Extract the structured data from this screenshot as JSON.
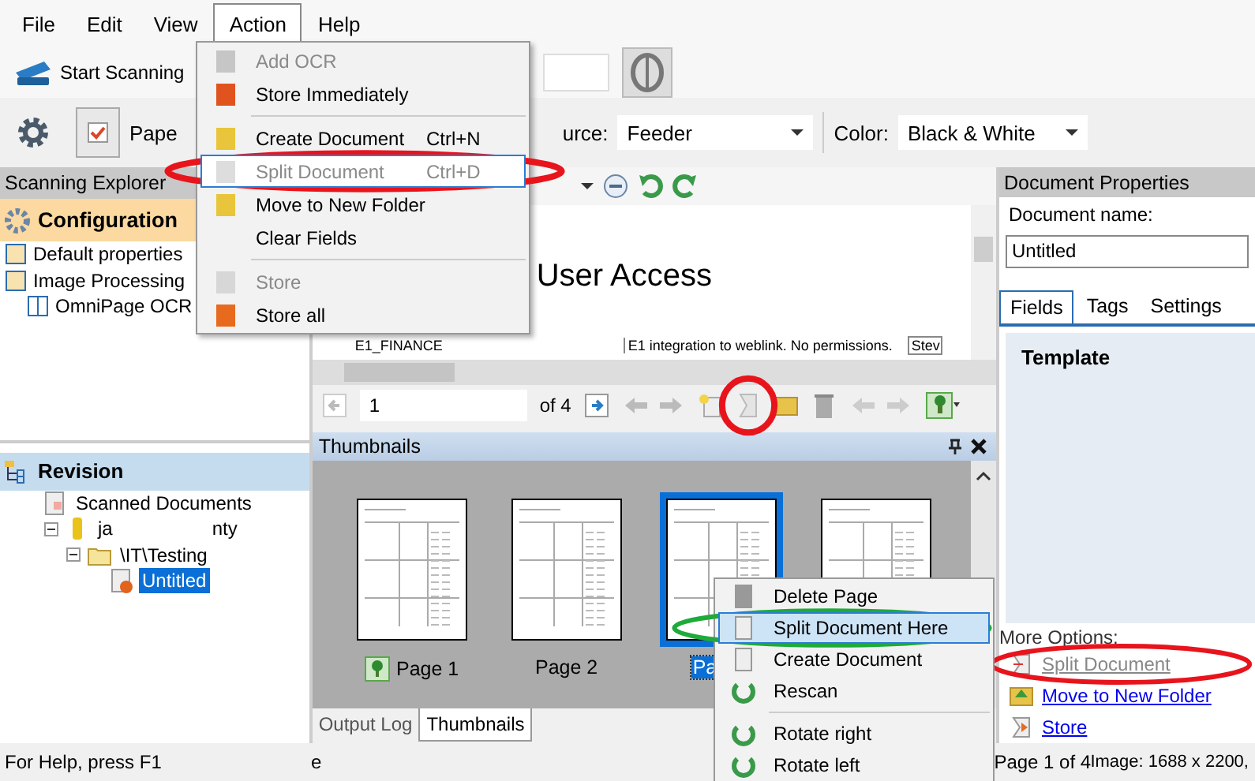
{
  "menubar": [
    {
      "label": "File",
      "selected": false
    },
    {
      "label": "Edit",
      "selected": false
    },
    {
      "label": "View",
      "selected": false
    },
    {
      "label": "Action",
      "selected": true
    },
    {
      "label": "Help",
      "selected": false
    }
  ],
  "action_menu": [
    {
      "kind": "item",
      "label": "Add OCR",
      "disabled": true,
      "highlighted": false
    },
    {
      "kind": "item",
      "label": "Store Immediately",
      "disabled": false,
      "highlighted": false
    },
    {
      "kind": "separator"
    },
    {
      "kind": "item",
      "label": "Create Document",
      "shortcut": "Ctrl+N",
      "disabled": false,
      "highlighted": false
    },
    {
      "kind": "item",
      "label": "Split Document",
      "shortcut": "Ctrl+D",
      "disabled": true,
      "highlighted": true
    },
    {
      "kind": "item",
      "label": "Move to New Folder",
      "disabled": false,
      "highlighted": false
    },
    {
      "kind": "item",
      "label": "Clear Fields",
      "disabled": false,
      "highlighted": false
    },
    {
      "kind": "separator"
    },
    {
      "kind": "item",
      "label": "Store",
      "disabled": true,
      "highlighted": false
    },
    {
      "kind": "item",
      "label": "Store all",
      "disabled": false,
      "highlighted": false
    }
  ],
  "toolbar": {
    "scan_button": "Start Scanning",
    "paper_label": "Pape",
    "source_label": "urce:",
    "source_value": "Feeder",
    "color_label": "Color:",
    "color_value": "Black & White"
  },
  "explorer": {
    "title": "Scanning Explorer",
    "configuration": "Configuration",
    "tree": [
      {
        "label": "Default properties"
      },
      {
        "label": "Image Processing",
        "children": [
          {
            "label": "OmniPage OCR"
          }
        ]
      }
    ]
  },
  "revision": {
    "title": "Revision",
    "tree": [
      {
        "label": "Scanned Documents",
        "selected": false,
        "children": [
          {
            "label": "ja",
            "label_end": "nty",
            "selected": false,
            "expanded": true,
            "children": [
              {
                "label": "\\IT\\Testing",
                "selected": false,
                "expanded": true,
                "children": [
                  {
                    "label": "Untitled",
                    "selected": true
                  }
                ]
              }
            ]
          }
        ]
      }
    ]
  },
  "viewer": {
    "heading": "User Access",
    "cell_left": "E1_FINANCE",
    "cell_right": "E1 integration to weblink.  No permissions.",
    "cell_cut": "Stev",
    "page": "1",
    "page_count": "of 4"
  },
  "thumbnails": {
    "title": "Thumbnails",
    "pages": [
      {
        "label": "Page 1",
        "selected": false,
        "flagged": true
      },
      {
        "label": "Page 2",
        "selected": false,
        "flagged": false
      },
      {
        "label": "Pa",
        "selected": true,
        "flagged": false
      },
      {
        "selected": false,
        "flagged": false
      }
    ],
    "tabs": [
      {
        "label": "Output Log",
        "selected": false
      },
      {
        "label": "Thumbnails",
        "selected": true
      }
    ]
  },
  "context_menu": [
    {
      "kind": "item",
      "label": "Delete Page",
      "highlighted": false
    },
    {
      "kind": "item",
      "label": "Split Document Here",
      "highlighted": true
    },
    {
      "kind": "item",
      "label": "Create Document",
      "highlighted": false
    },
    {
      "kind": "item",
      "label": "Rescan",
      "highlighted": false
    },
    {
      "kind": "separator"
    },
    {
      "kind": "item",
      "label": "Rotate right",
      "highlighted": false
    },
    {
      "kind": "item",
      "label": "Rotate left",
      "highlighted": false
    }
  ],
  "properties": {
    "title": "Document Properties",
    "name_label": "Document name:",
    "name_value": "Untitled",
    "tabs": [
      {
        "label": "Fields",
        "selected": true
      },
      {
        "label": "Tags",
        "selected": false
      },
      {
        "label": "Settings",
        "selected": false
      }
    ],
    "template": "Template",
    "more_label": "More Options:",
    "links": [
      {
        "label": "Split Document",
        "disabled": true
      },
      {
        "label": "Move to New Folder",
        "disabled": false
      },
      {
        "label": "Store",
        "disabled": false
      }
    ]
  },
  "status_bar": {
    "help": "For Help, press F1",
    "fragment": "e",
    "page": "Page 1 of 4",
    "image": "Image: 1688 x 2200,"
  },
  "annotations": [
    {
      "kind": "ellipse",
      "color": "#e8141c"
    },
    {
      "kind": "ellipse",
      "color": "#e8141c"
    },
    {
      "kind": "ellipse",
      "color": "#1faa3a"
    },
    {
      "kind": "ellipse",
      "color": "#e8141c"
    }
  ]
}
